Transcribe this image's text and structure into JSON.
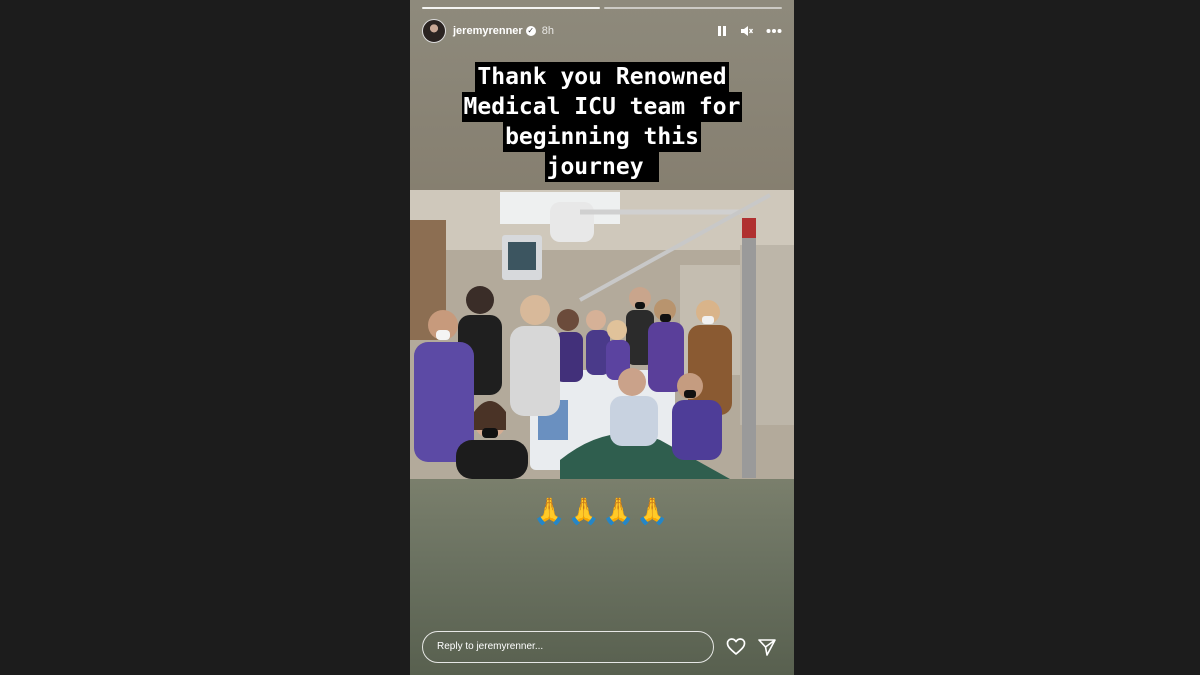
{
  "story": {
    "username": "jeremyrenner",
    "verified_icon": "verified-badge-icon",
    "time_ago": "8h",
    "progress_segments": 2,
    "icons": {
      "pause": "pause-icon",
      "mute": "speaker-muted-icon",
      "more": "more-options-icon",
      "heart": "heart-icon",
      "send": "send-paper-plane-icon"
    },
    "caption_lines": [
      "Thank you Renowned",
      "Medical ICU team for",
      "beginning this",
      "journey "
    ],
    "photo": "hospital ICU group photo",
    "emoji": "🙏🙏🙏🙏",
    "reply_placeholder": "Reply to jeremyrenner..."
  },
  "colors": {
    "page_background": "#1c1c1c",
    "caption_background": "#000000",
    "caption_text": "#ffffff"
  }
}
